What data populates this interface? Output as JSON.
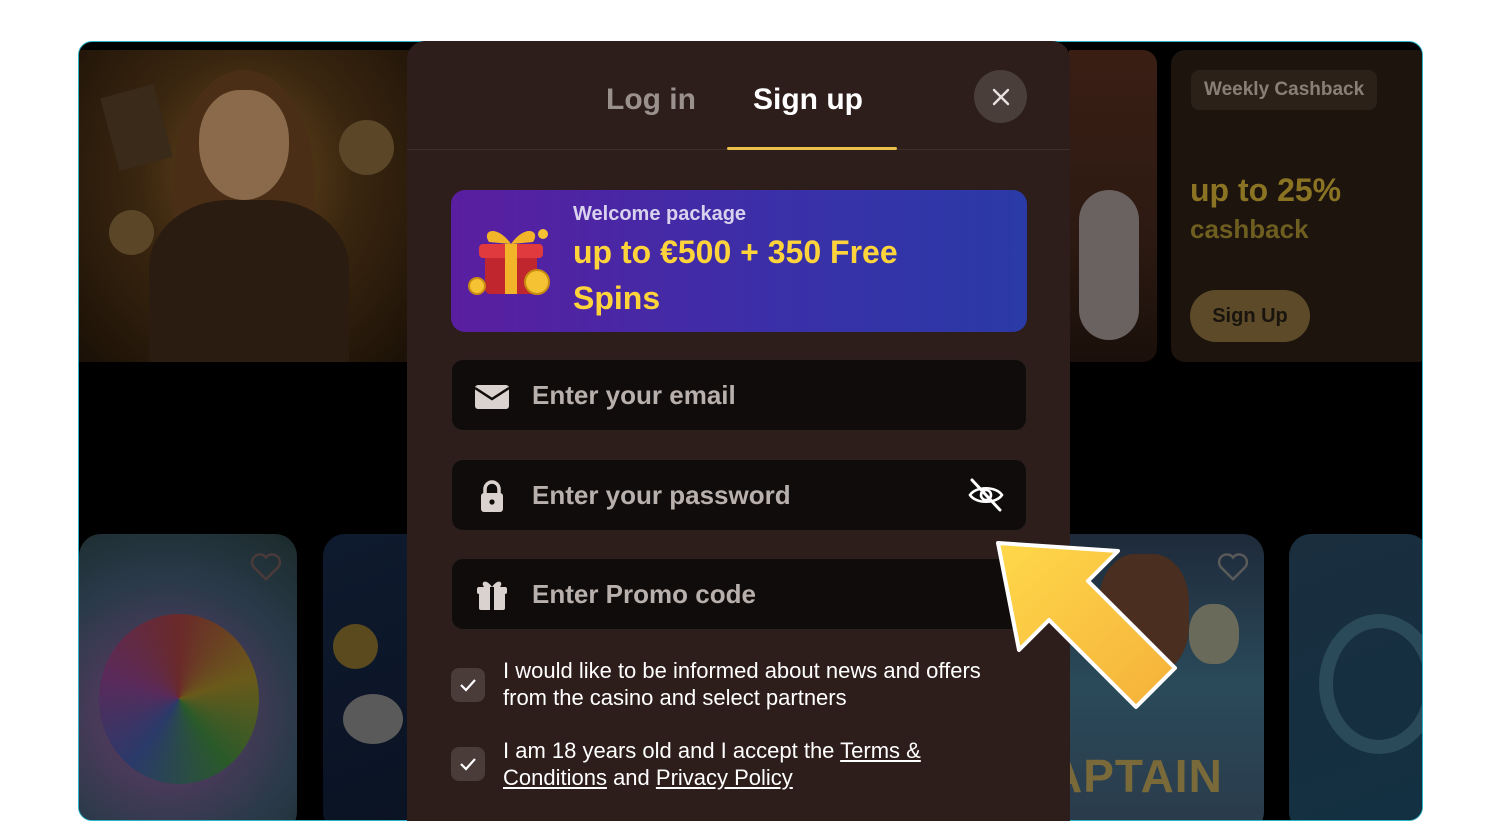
{
  "modal": {
    "tabs": {
      "login": "Log in",
      "signup": "Sign up"
    },
    "promo": {
      "label": "Welcome package",
      "title": "up to €500 + 350 Free Spins"
    },
    "fields": {
      "email_placeholder": "Enter your email",
      "password_placeholder": "Enter your password",
      "promo_placeholder": "Enter Promo code"
    },
    "checkboxes": {
      "news_text": "I would like to be informed about news and offers from the casino and select partners",
      "age_prefix": "I am 18 years old and I accept the ",
      "terms_link": "Terms & Conditions",
      "age_mid": " and ",
      "privacy_link": "Privacy Policy"
    }
  },
  "background": {
    "cashback": {
      "badge": "Weekly Cashback",
      "amount": "up to 25%",
      "sub": "cashback",
      "button": "Sign Up"
    },
    "game_title": "APTAIN"
  },
  "colors": {
    "accent": "#e8c04a",
    "promo_text": "#ffd43a",
    "modal_bg": "#2d1d1b"
  }
}
